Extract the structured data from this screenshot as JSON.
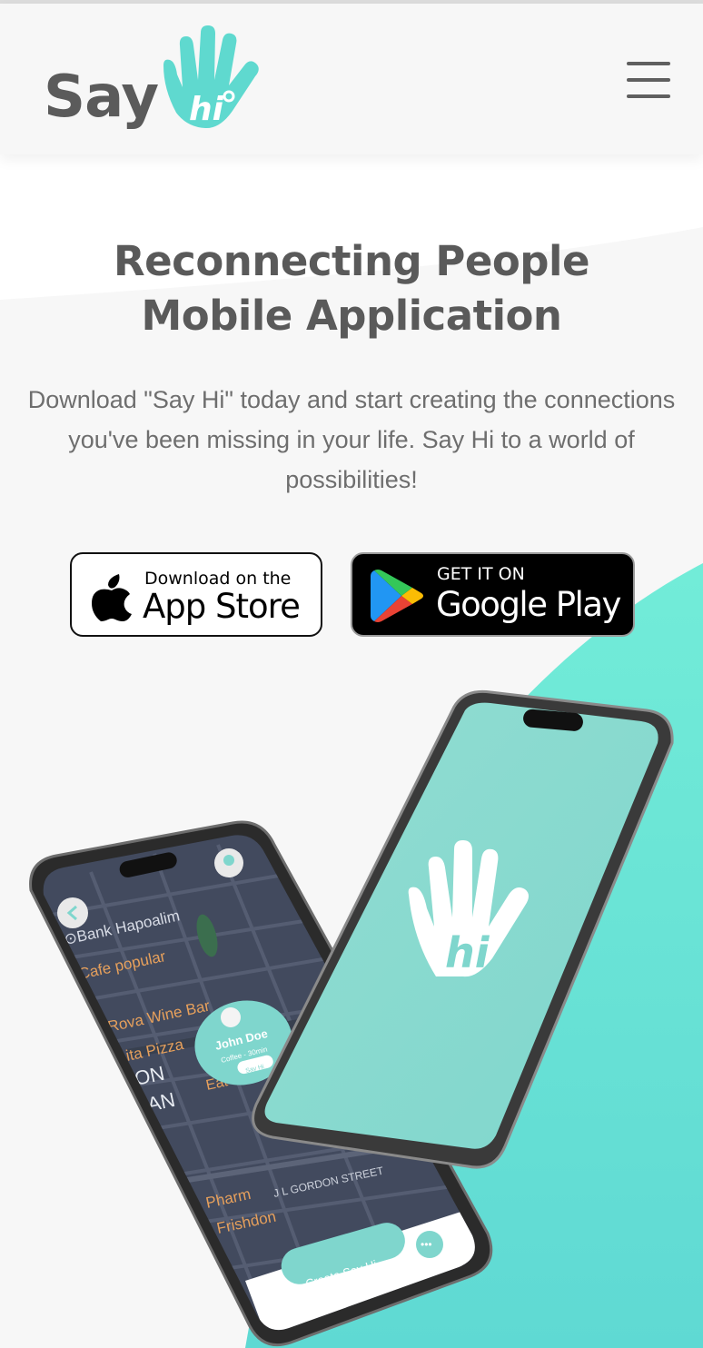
{
  "brand": {
    "say": "Say",
    "hi": "hi"
  },
  "header": {
    "menu_icon": "hamburger-menu-icon"
  },
  "hero": {
    "title_line1": "Reconnecting People",
    "title_line2": "Mobile Application",
    "subtitle": "Download \"Say Hi\" today and start creating the connections you've been missing in your life. Say Hi to a world of possibilities!"
  },
  "stores": {
    "apple": {
      "small": "Download on the",
      "big": "App Store"
    },
    "google": {
      "small": "GET IT ON",
      "big": "Google Play"
    }
  },
  "mockup": {
    "map_labels": [
      "Bank Hapoalim",
      "Cafe popular",
      "Rova Wine Bar",
      "ita Pizza",
      "Eat",
      "Pharm",
      "Frishdon",
      "J L GORDON STREET",
      "ON",
      "IAN"
    ],
    "card_name": "John Doe",
    "card_detail": "Coffee - 30min",
    "card_button": "Say Hi",
    "create_button": "Create Say Hi"
  },
  "colors": {
    "accent": "#5fd9cf",
    "teal_shape": "#6fe8d6",
    "text_dark": "#5a5a5a",
    "text_muted": "#6e6e6e"
  }
}
